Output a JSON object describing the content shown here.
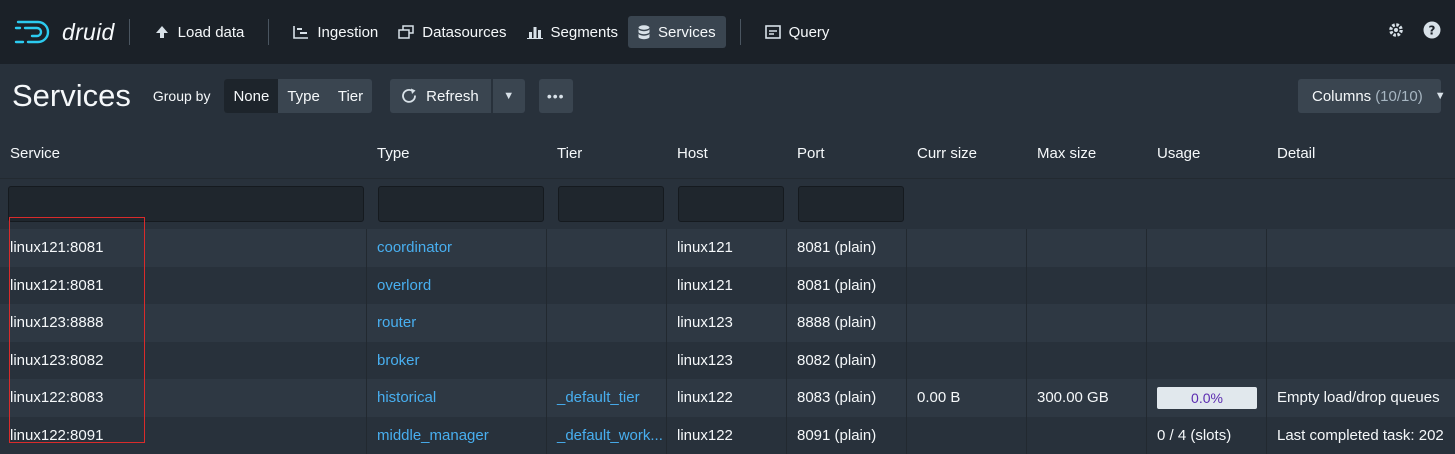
{
  "app": {
    "name": "druid"
  },
  "nav": {
    "items": [
      {
        "label": "Load data",
        "icon": "cloud-upload-icon"
      },
      {
        "label": "Ingestion",
        "icon": "gantt-chart-icon"
      },
      {
        "label": "Datasources",
        "icon": "multi-select-icon"
      },
      {
        "label": "Segments",
        "icon": "stacked-chart-icon"
      },
      {
        "label": "Services",
        "icon": "database-icon",
        "active": true
      },
      {
        "label": "Query",
        "icon": "application-icon"
      }
    ],
    "right_icons": [
      "cog-icon",
      "help-icon"
    ]
  },
  "controls": {
    "title": "Services",
    "group_by_label": "Group by",
    "group_by_options": [
      "None",
      "Type",
      "Tier"
    ],
    "group_by_selected": "None",
    "refresh_label": "Refresh",
    "columns_label": "Columns",
    "columns_count": "(10/10)"
  },
  "table": {
    "columns": [
      "Service",
      "Type",
      "Tier",
      "Host",
      "Port",
      "Curr size",
      "Max size",
      "Usage",
      "Detail"
    ],
    "rows": [
      {
        "service": "linux121:8081",
        "type": "coordinator",
        "tier": "",
        "host": "linux121",
        "port": "8081 (plain)",
        "curr": "",
        "max": "",
        "usage": "",
        "detail": ""
      },
      {
        "service": "linux121:8081",
        "type": "overlord",
        "tier": "",
        "host": "linux121",
        "port": "8081 (plain)",
        "curr": "",
        "max": "",
        "usage": "",
        "detail": ""
      },
      {
        "service": "linux123:8888",
        "type": "router",
        "tier": "",
        "host": "linux123",
        "port": "8888 (plain)",
        "curr": "",
        "max": "",
        "usage": "",
        "detail": ""
      },
      {
        "service": "linux123:8082",
        "type": "broker",
        "tier": "",
        "host": "linux123",
        "port": "8082 (plain)",
        "curr": "",
        "max": "",
        "usage": "",
        "detail": ""
      },
      {
        "service": "linux122:8083",
        "type": "historical",
        "tier": "_default_tier",
        "host": "linux122",
        "port": "8083 (plain)",
        "curr": "0.00 B",
        "max": "300.00 GB",
        "usage": "0.0%",
        "detail": "Empty load/drop queues"
      },
      {
        "service": "linux122:8091",
        "type": "middle_manager",
        "tier": "_default_work...",
        "host": "linux122",
        "port": "8091 (plain)",
        "curr": "",
        "max": "",
        "usage": "0 / 4 (slots)",
        "detail": "Last completed task: 202"
      }
    ]
  },
  "colors": {
    "link": "#48aff0",
    "highlight": "#d92b2b",
    "background": "#28313b",
    "nav": "#1b2128"
  }
}
